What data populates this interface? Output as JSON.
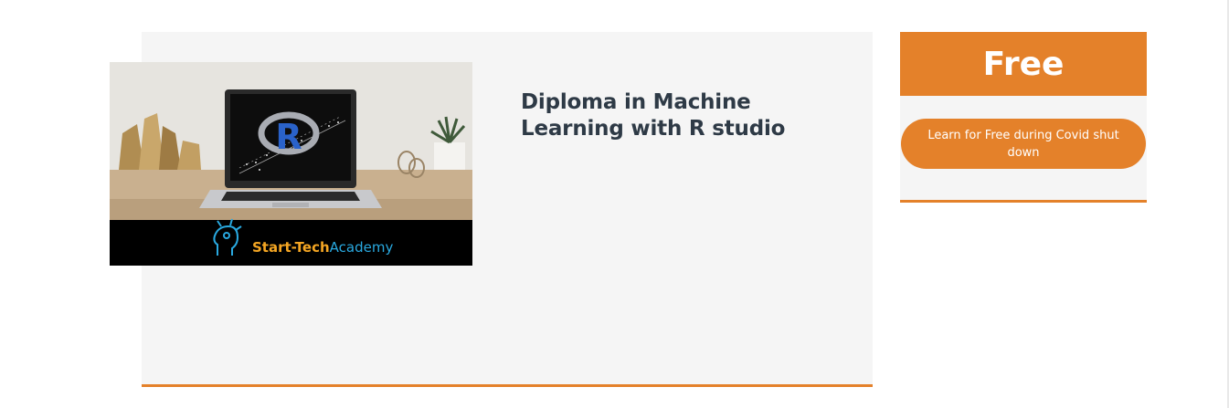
{
  "course": {
    "title": "Diploma in Machine Learning with R studio",
    "thumbnail": {
      "brand_primary": "Start-Tech",
      "brand_secondary": "Academy",
      "screen_logo_letter": "R"
    }
  },
  "pricing": {
    "price_label": "Free",
    "cta_label": "Learn for Free during Covid shut down"
  },
  "colors": {
    "accent": "#e4812a",
    "card_background": "#f5f5f5",
    "title_text": "#2e3a46"
  }
}
